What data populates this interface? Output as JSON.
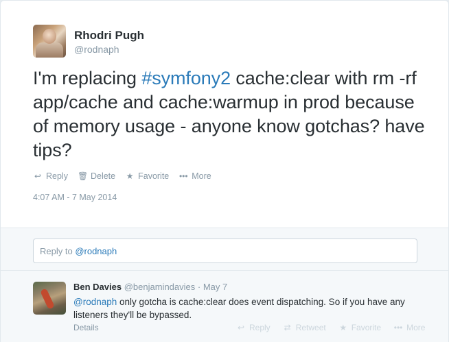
{
  "tweet": {
    "fullname": "Rhodri Pugh",
    "username": "@rodnaph",
    "text_before": "I'm replacing ",
    "hashtag": "#symfony2",
    "text_after": " cache:clear with rm -rf app/cache and cache:warmup in prod because of memory usage - anyone know gotchas? have tips?",
    "timestamp": "4:07 AM - 7 May 2014",
    "actions": {
      "reply": "Reply",
      "delete": "Delete",
      "favorite": "Favorite",
      "more": "More"
    }
  },
  "reply_box": {
    "prefix": "Reply to ",
    "mention": "@rodnaph"
  },
  "reply_tweet": {
    "fullname": "Ben Davies",
    "username": "@benjamindavies",
    "separator": " · ",
    "date": "May 7",
    "mention": "@rodnaph",
    "text": " only gotcha is cache:clear does event dispatching. So if you have any listeners they'll be bypassed.",
    "details": "Details",
    "actions": {
      "reply": "Reply",
      "retweet": "Retweet",
      "favorite": "Favorite",
      "more": "More"
    }
  },
  "colors": {
    "link": "#2b7bb9",
    "muted": "#8899a6",
    "text": "#292f33"
  }
}
